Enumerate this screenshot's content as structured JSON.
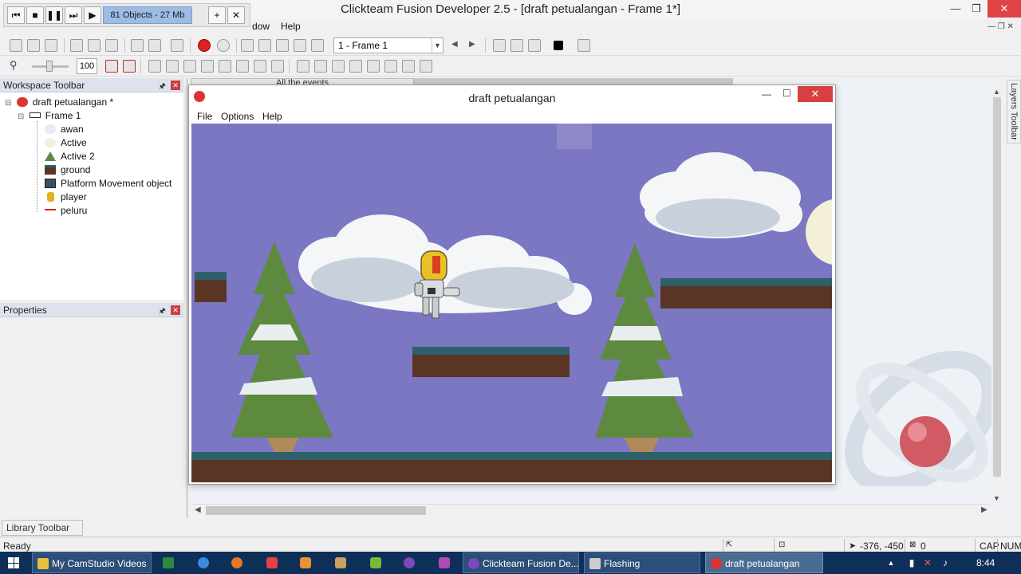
{
  "app": {
    "title": "Clickteam Fusion Developer 2.5 - [draft petualangan - Frame 1*]"
  },
  "debug_toolbar": {
    "object_count": "81 Objects - 27 Mb"
  },
  "menu": {
    "items": [
      "dow",
      "Help"
    ]
  },
  "toolbar": {
    "frame_select": "1 - Frame 1",
    "zoom": "100"
  },
  "workspace": {
    "header": "Workspace Toolbar",
    "tree": [
      {
        "label": "draft petualangan *",
        "icon": "app-icon"
      },
      {
        "label": "Frame 1",
        "icon": "frame-icon"
      },
      {
        "label": "awan",
        "icon": "cloud-icon"
      },
      {
        "label": "Active",
        "icon": "active-icon"
      },
      {
        "label": "Active 2",
        "icon": "tree-icon"
      },
      {
        "label": "ground",
        "icon": "ground-icon"
      },
      {
        "label": "Platform Movement object",
        "icon": "platform-icon"
      },
      {
        "label": "player",
        "icon": "player-icon"
      },
      {
        "label": "peluru",
        "icon": "bullet-icon"
      }
    ]
  },
  "properties": {
    "header": "Properties"
  },
  "editor": {
    "events_tab": "All the events",
    "layers_label": "Layers Toolbar"
  },
  "game_window": {
    "title": "draft petualangan",
    "menu": [
      "File",
      "Options",
      "Help"
    ]
  },
  "library": {
    "label": "Library Toolbar"
  },
  "status": {
    "ready": "Ready",
    "coords": "-376, -450",
    "count": "0",
    "cap": "CAP",
    "num": "NUM"
  },
  "taskbar": {
    "items": [
      {
        "label": "My CamStudio Videos",
        "state": "open"
      },
      {
        "label": "Clickteam Fusion De...",
        "state": "open"
      },
      {
        "label": "Flashing",
        "state": "open"
      },
      {
        "label": "draft petualangan",
        "state": "active"
      }
    ],
    "clock": "8:44"
  },
  "colors": {
    "sky": "#7b77c2",
    "grass_top": "#2e5f6a",
    "dirt": "#5a3524",
    "tree": "#5e8a40",
    "taskbar": "#0e2f58"
  }
}
